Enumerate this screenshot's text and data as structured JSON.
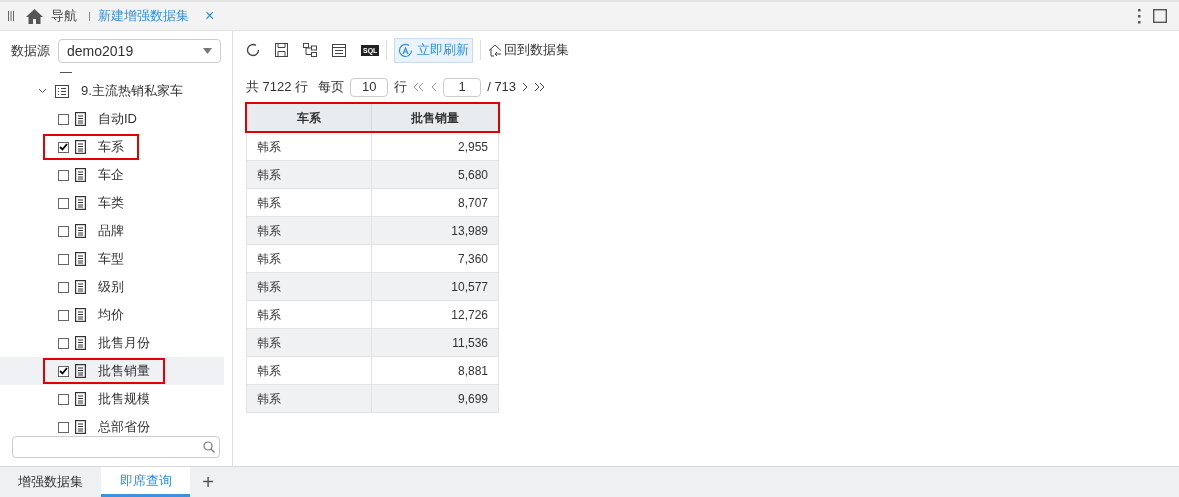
{
  "tabs": [
    {
      "label": "导航",
      "kind": "home",
      "selected": false
    },
    {
      "label": "新建增强数据集",
      "kind": "doc",
      "selected": true,
      "close": "×"
    }
  ],
  "sidebar": {
    "datasource_label": "数据源",
    "datasource": "demo2019",
    "tree": {
      "label": "9.主流热销私家车",
      "expanded": true,
      "children": [
        {
          "label": "自动ID",
          "checked": false,
          "highlighted": false,
          "selected": false
        },
        {
          "label": "车系",
          "checked": true,
          "highlighted": true,
          "selected": false
        },
        {
          "label": "车企",
          "checked": false,
          "highlighted": false,
          "selected": false
        },
        {
          "label": "车类",
          "checked": false,
          "highlighted": false,
          "selected": false
        },
        {
          "label": "品牌",
          "checked": false,
          "highlighted": false,
          "selected": false
        },
        {
          "label": "车型",
          "checked": false,
          "highlighted": false,
          "selected": false
        },
        {
          "label": "级别",
          "checked": false,
          "highlighted": false,
          "selected": false
        },
        {
          "label": "均价",
          "checked": false,
          "highlighted": false,
          "selected": false
        },
        {
          "label": "批售月份",
          "checked": false,
          "highlighted": false,
          "selected": false
        },
        {
          "label": "批售销量",
          "checked": true,
          "highlighted": true,
          "selected": true
        },
        {
          "label": "批售规模",
          "checked": false,
          "highlighted": false,
          "selected": false
        },
        {
          "label": "总部省份",
          "checked": false,
          "highlighted": false,
          "selected": false
        }
      ]
    }
  },
  "toolbar": {
    "refresh_now": "立即刷新",
    "back": "回到数据集",
    "sql": "SQL"
  },
  "pagination": {
    "total": "共 7122 行",
    "per_page_label": "每页",
    "per_page": "10",
    "row_unit": "行",
    "page": "1",
    "pages": "/ 713"
  },
  "table": {
    "header_highlighted": true,
    "columns": [
      "车系",
      "批售销量"
    ],
    "rows": [
      [
        "韩系",
        "2,955"
      ],
      [
        "韩系",
        "5,680"
      ],
      [
        "韩系",
        "8,707"
      ],
      [
        "韩系",
        "13,989"
      ],
      [
        "韩系",
        "7,360"
      ],
      [
        "韩系",
        "10,577"
      ],
      [
        "韩系",
        "12,726"
      ],
      [
        "韩系",
        "11,536"
      ],
      [
        "韩系",
        "8,881"
      ],
      [
        "韩系",
        "9,699"
      ]
    ]
  },
  "bottom_tabs": [
    {
      "label": "增强数据集",
      "selected": false
    },
    {
      "label": "即席查询",
      "selected": true
    }
  ],
  "add_tab": "+"
}
